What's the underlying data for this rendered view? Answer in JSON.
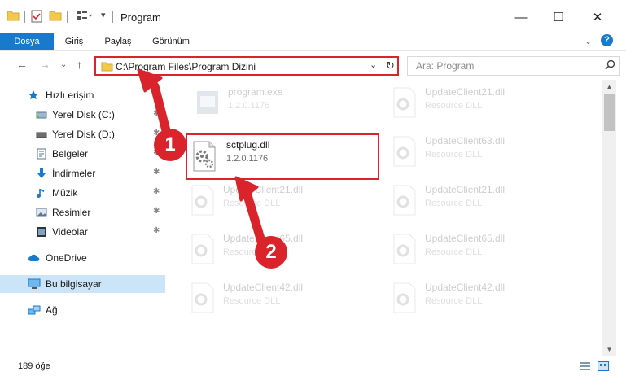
{
  "window": {
    "title": "Program",
    "minimize": "—",
    "maximize": "☐",
    "close": "✕"
  },
  "ribbon": {
    "tabs": [
      "Dosya",
      "Giriş",
      "Paylaş",
      "Görünüm"
    ],
    "active_tab": "Dosya",
    "help": "?"
  },
  "address": {
    "path": "C:\\Program Files\\Program Dizini",
    "refresh": "↻"
  },
  "search": {
    "placeholder": "Ara: Program"
  },
  "sidebar": {
    "items": [
      {
        "label": "Hızlı erişim",
        "icon": "star-icon"
      },
      {
        "label": "Yerel Disk (C:)",
        "icon": "drive-icon",
        "pinned": true
      },
      {
        "label": "Yerel Disk (D:)",
        "icon": "drive-icon",
        "pinned": true
      },
      {
        "label": "Belgeler",
        "icon": "document-icon",
        "pinned": true
      },
      {
        "label": "İndirmeler",
        "icon": "download-icon",
        "pinned": true
      },
      {
        "label": "Müzik",
        "icon": "music-icon",
        "pinned": true
      },
      {
        "label": "Resimler",
        "icon": "pictures-icon",
        "pinned": true
      },
      {
        "label": "Videolar",
        "icon": "video-icon",
        "pinned": true
      },
      {
        "label": "OneDrive",
        "icon": "cloud-icon"
      },
      {
        "label": "Bu bilgisayar",
        "icon": "computer-icon",
        "selected": true
      },
      {
        "label": "Ağ",
        "icon": "network-icon"
      }
    ]
  },
  "files": [
    {
      "name": "program.exe",
      "sub": "1.2.0.1176"
    },
    {
      "name": "UpdateClient21.dll",
      "sub": "Resource DLL"
    },
    {
      "name": "sctplug.dll",
      "sub": "1.2.0.1176"
    },
    {
      "name": "UpdateClient63.dll",
      "sub": "Resource DLL"
    },
    {
      "name": "UpdateClient21.dll",
      "sub": "Resource DLL"
    },
    {
      "name": "UpdateClient21.dll",
      "sub": "Resource DLL"
    },
    {
      "name": "UpdateClient65.dll",
      "sub": "Resource DLL"
    },
    {
      "name": "UpdateClient65.dll",
      "sub": "Resource DLL"
    },
    {
      "name": "UpdateClient42.dll",
      "sub": "Resource DLL"
    },
    {
      "name": "UpdateClient42.dll",
      "sub": "Resource DLL"
    }
  ],
  "annotations": {
    "step1": "1",
    "step2": "2"
  },
  "status": {
    "item_count": "189 öğe"
  },
  "colors": {
    "accent": "#1979ca",
    "highlight": "#d9242b",
    "selected_bg": "#cce4f7"
  }
}
